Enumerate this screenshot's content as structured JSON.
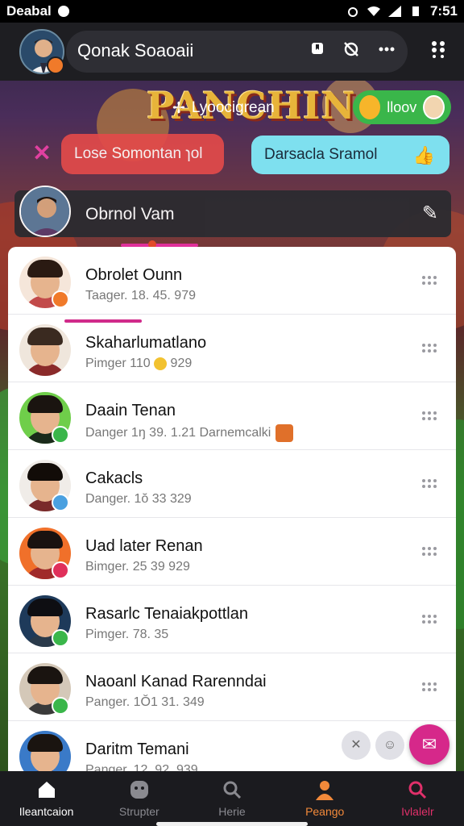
{
  "status_bar": {
    "carrier": "Deabal",
    "time": "7:51"
  },
  "header": {
    "title": "Qonak Soaoaii"
  },
  "overlay": {
    "top_chip": "Lyoocigrean",
    "green_chip": "lloov",
    "red_bubble": "Lose Somontan ɿol",
    "cyan_bubble": "Darsacla Sramol",
    "me_name": "Obrnol Vam"
  },
  "contacts": [
    {
      "name": "Obrolet Ounn",
      "sub": "Taager. 18. 45. 979",
      "status_color": "#f07a2a",
      "avatar_bg": "#f5e6da",
      "hair": "#2a1a12",
      "shirt": "#c24a4a"
    },
    {
      "name": "Skaharlumatlano",
      "sub": "Pimger 110",
      "sub2": "929",
      "status_color": "",
      "avatar_bg": "#efe6dc",
      "hair": "#3a2a20",
      "shirt": "#8a2a2a"
    },
    {
      "name": "Daain Tenan",
      "sub": "Danger 1ŋ 39. 1.21 Darnemcalki",
      "status_color": "#3ab64a",
      "avatar_bg": "#6fce4a",
      "hair": "#1a1410",
      "shirt": "#1a2a1a"
    },
    {
      "name": "Cakacls",
      "sub": "Danger. 1ŏ 33 329",
      "status_color": "#4aa0e0",
      "avatar_bg": "#f0ece8",
      "hair": "#120c08",
      "shirt": "#7a2a2a"
    },
    {
      "name": "Uad later Renan",
      "sub": "Bimger. 25 39 929",
      "status_color": "#e0305a",
      "avatar_bg": "#f0702a",
      "hair": "#1a1210",
      "shirt": "#a02a2a"
    },
    {
      "name": "Rasarlc Tenaiakpottlan",
      "sub": "Pimger. 78. 35",
      "status_color": "#3ab64a",
      "avatar_bg": "#1e3a5a",
      "hair": "#0e0e12",
      "shirt": "#2a3a4a"
    },
    {
      "name": "Naoanl Kanad Rarenndai",
      "sub": "Panger. 1Ŏ1 31. 349",
      "status_color": "#3ab64a",
      "avatar_bg": "#d4c8b8",
      "hair": "#1a1410",
      "shirt": "#3a3a3a"
    },
    {
      "name": "Daritm Temani",
      "sub": "Panger. 12. 92. 939",
      "status_color": "",
      "avatar_bg": "#3a7ac8",
      "hair": "#1a1410",
      "shirt": "#2a3a6a"
    }
  ],
  "bottom_nav": [
    {
      "label": "Ileantcaion",
      "icon": "home-icon",
      "color": "#ffffff"
    },
    {
      "label": "Strupter",
      "icon": "face-icon",
      "color": "#8a8a90"
    },
    {
      "label": "Herie",
      "icon": "search-icon",
      "color": "#8a8a90"
    },
    {
      "label": "Peango",
      "icon": "person-icon",
      "color": "#f2893a"
    },
    {
      "label": "Ivlalelr",
      "icon": "search-icon",
      "color": "#e0306a"
    }
  ],
  "colors": {
    "accent": "#d6288a",
    "header_bg": "#1e1e22"
  }
}
